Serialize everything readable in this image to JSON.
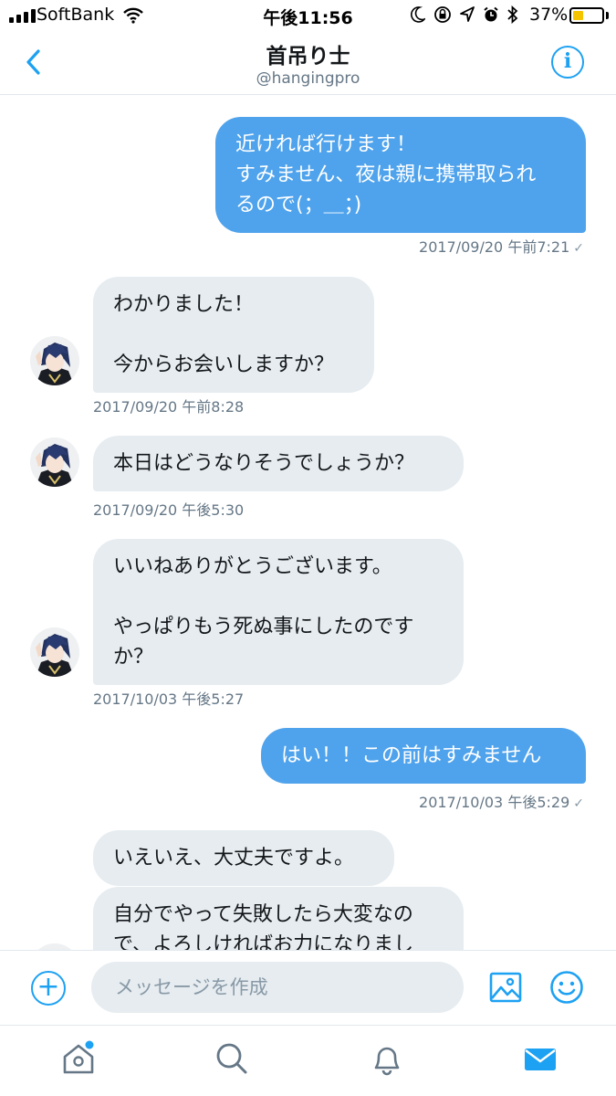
{
  "status_bar": {
    "carrier": "SoftBank",
    "time": "午後11:56",
    "battery_percent": "37%",
    "battery_level": 0.37,
    "icons": [
      "signal-icon",
      "wifi-icon",
      "moon-icon",
      "orientation-lock-icon",
      "location-icon",
      "alarm-icon",
      "bluetooth-icon",
      "battery-icon"
    ]
  },
  "header": {
    "title": "首吊り士",
    "handle": "@hangingpro",
    "info_label": "i"
  },
  "messages": [
    {
      "direction": "sent",
      "text": "近ければ行けます！\nすみません、夜は親に携帯取られ\nるので(；＿；)",
      "timestamp": "2017/09/20 午前7:21"
    },
    {
      "direction": "received",
      "text": "わかりました！\n\n今からお会いしますか？",
      "timestamp": "2017/09/20 午前8:28"
    },
    {
      "direction": "received",
      "text": "本日はどうなりそうでしょうか？",
      "timestamp": "2017/09/20 午後5:30"
    },
    {
      "direction": "received",
      "text": "いいねありがとうございます。\n\nやっぱりもう死ぬ事にしたのです\nか？",
      "timestamp": "2017/10/03 午後5:27"
    },
    {
      "direction": "sent",
      "text": "はい！！この前はすみません",
      "timestamp": "2017/10/03 午後5:29"
    },
    {
      "direction": "received",
      "text": "いえいえ、大丈夫ですよ。"
    },
    {
      "direction": "received",
      "text": "自分でやって失敗したら大変なの\nで、よろしければお力になりまし"
    }
  ],
  "read_check": "✓",
  "compose": {
    "placeholder": "メッセージを作成",
    "add_label": "+"
  },
  "tabs": [
    "home-icon",
    "search-icon",
    "notifications-icon",
    "messages-icon"
  ],
  "colors": {
    "accent": "#1da1f2",
    "sent_bubble": "#4fa3ec",
    "received_bubble": "#e6ecf0",
    "meta_text": "#657786",
    "battery": "#f5c400"
  }
}
